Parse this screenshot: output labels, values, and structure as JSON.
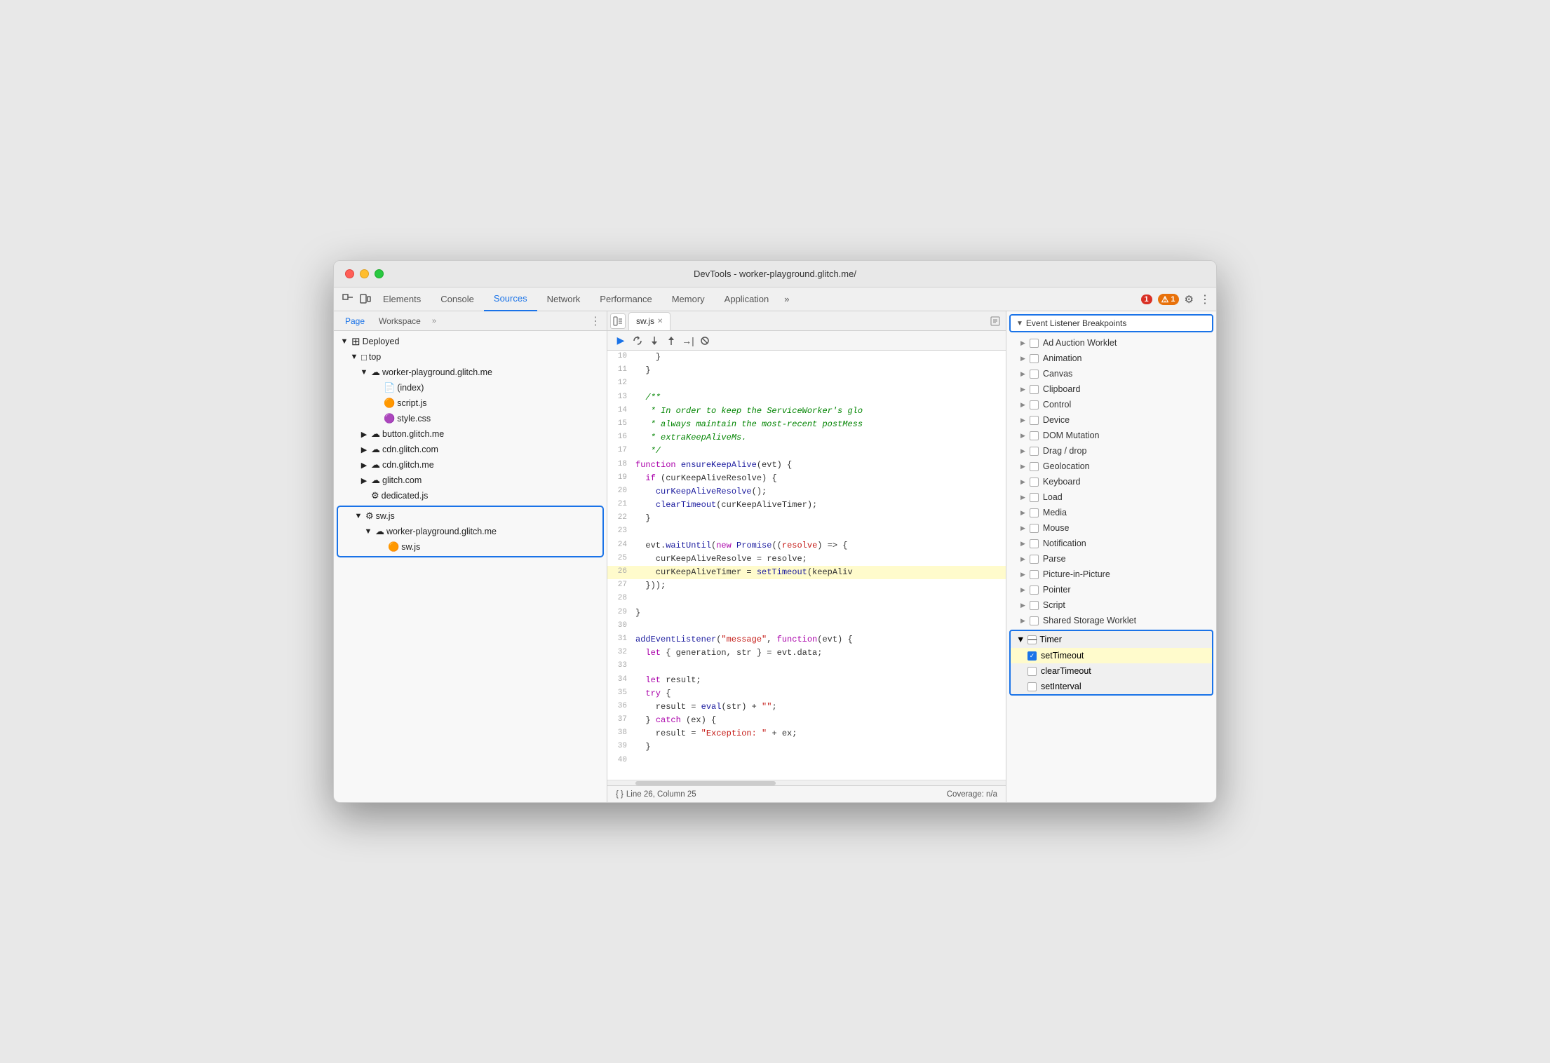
{
  "window": {
    "title": "DevTools - worker-playground.glitch.me/"
  },
  "topbar": {
    "tabs": [
      {
        "label": "Elements",
        "active": false
      },
      {
        "label": "Console",
        "active": false
      },
      {
        "label": "Sources",
        "active": true
      },
      {
        "label": "Network",
        "active": false
      },
      {
        "label": "Performance",
        "active": false
      },
      {
        "label": "Memory",
        "active": false
      },
      {
        "label": "Application",
        "active": false
      }
    ],
    "error_count": "1",
    "warn_count": "1"
  },
  "file_panel": {
    "tabs": [
      "Page",
      "Workspace"
    ],
    "active_tab": "Page",
    "tree": [
      {
        "level": 0,
        "label": "Deployed",
        "type": "folder",
        "indent": 8
      },
      {
        "level": 1,
        "label": "top",
        "type": "folder",
        "indent": 22
      },
      {
        "level": 2,
        "label": "worker-playground.glitch.me",
        "type": "cloud-folder",
        "indent": 36
      },
      {
        "level": 3,
        "label": "(index)",
        "type": "file",
        "indent": 52
      },
      {
        "level": 3,
        "label": "script.js",
        "type": "file-orange",
        "indent": 52
      },
      {
        "level": 3,
        "label": "style.css",
        "type": "file-purple",
        "indent": 52
      },
      {
        "level": 2,
        "label": "button.glitch.me",
        "type": "cloud-folder",
        "indent": 36
      },
      {
        "level": 2,
        "label": "cdn.glitch.com",
        "type": "cloud-folder",
        "indent": 36
      },
      {
        "level": 2,
        "label": "cdn.glitch.me",
        "type": "cloud-folder",
        "indent": 36
      },
      {
        "level": 2,
        "label": "glitch.com",
        "type": "cloud-folder",
        "indent": 36
      },
      {
        "level": 2,
        "label": "dedicated.js",
        "type": "gear-file",
        "indent": 36
      },
      {
        "level": 1,
        "label": "sw.js",
        "type": "gear-file",
        "indent": 22,
        "selected_group_start": true
      },
      {
        "level": 2,
        "label": "worker-playground.glitch.me",
        "type": "cloud-folder",
        "indent": 36
      },
      {
        "level": 3,
        "label": "sw.js",
        "type": "file-orange",
        "indent": 52,
        "selected_group_end": true
      }
    ]
  },
  "code_editor": {
    "filename": "sw.js",
    "lines": [
      {
        "num": 10,
        "content": "    }"
      },
      {
        "num": 11,
        "content": "  }"
      },
      {
        "num": 12,
        "content": ""
      },
      {
        "num": 13,
        "content": "  /**",
        "type": "comment"
      },
      {
        "num": 14,
        "content": "   * In order to keep the ServiceWorker's glo",
        "type": "comment"
      },
      {
        "num": 15,
        "content": "   * always maintain the most-recent postMess",
        "type": "comment"
      },
      {
        "num": 16,
        "content": "   * extraKeepAliveMs.",
        "type": "comment"
      },
      {
        "num": 17,
        "content": "   */",
        "type": "comment"
      },
      {
        "num": 18,
        "content": "function ensureKeepAlive(evt) {"
      },
      {
        "num": 19,
        "content": "  if (curKeepAliveResolve) {"
      },
      {
        "num": 20,
        "content": "    curKeepAliveResolve();"
      },
      {
        "num": 21,
        "content": "    clearTimeout(curKeepAliveTimer);"
      },
      {
        "num": 22,
        "content": "  }"
      },
      {
        "num": 23,
        "content": ""
      },
      {
        "num": 24,
        "content": "  evt.waitUntil(new Promise((resolve) => {"
      },
      {
        "num": 25,
        "content": "    curKeepAliveResolve = resolve;"
      },
      {
        "num": 26,
        "content": "    curKeepAliveTimer = setTimeout(keepAliv",
        "highlighted": true
      },
      {
        "num": 27,
        "content": "  }));"
      },
      {
        "num": 28,
        "content": ""
      },
      {
        "num": 29,
        "content": "}"
      },
      {
        "num": 30,
        "content": ""
      },
      {
        "num": 31,
        "content": "addEventListener(\"message\", function(evt) {"
      },
      {
        "num": 32,
        "content": "  let { generation, str } = evt.data;"
      },
      {
        "num": 33,
        "content": ""
      },
      {
        "num": 34,
        "content": "  let result;"
      },
      {
        "num": 35,
        "content": "  try {"
      },
      {
        "num": 36,
        "content": "    result = eval(str) + \"\";"
      },
      {
        "num": 37,
        "content": "  } catch (ex) {"
      },
      {
        "num": 38,
        "content": "    result = \"Exception: \" + ex;"
      },
      {
        "num": 39,
        "content": "  }"
      },
      {
        "num": 40,
        "content": ""
      }
    ],
    "statusbar": {
      "format_icon": "{ }",
      "position": "Line 26, Column 25",
      "coverage": "Coverage: n/a"
    }
  },
  "breakpoints": {
    "section_title": "Event Listener Breakpoints",
    "items": [
      {
        "label": "Ad Auction Worklet",
        "checked": false,
        "expandable": true
      },
      {
        "label": "Animation",
        "checked": false,
        "expandable": true
      },
      {
        "label": "Canvas",
        "checked": false,
        "expandable": true
      },
      {
        "label": "Clipboard",
        "checked": false,
        "expandable": true
      },
      {
        "label": "Control",
        "checked": false,
        "expandable": true
      },
      {
        "label": "Device",
        "checked": false,
        "expandable": true
      },
      {
        "label": "DOM Mutation",
        "checked": false,
        "expandable": true
      },
      {
        "label": "Drag / drop",
        "checked": false,
        "expandable": true
      },
      {
        "label": "Geolocation",
        "checked": false,
        "expandable": true
      },
      {
        "label": "Keyboard",
        "checked": false,
        "expandable": true
      },
      {
        "label": "Load",
        "checked": false,
        "expandable": true
      },
      {
        "label": "Media",
        "checked": false,
        "expandable": true
      },
      {
        "label": "Mouse",
        "checked": false,
        "expandable": true
      },
      {
        "label": "Notification",
        "checked": false,
        "expandable": true
      },
      {
        "label": "Parse",
        "checked": false,
        "expandable": true
      },
      {
        "label": "Picture-in-Picture",
        "checked": false,
        "expandable": true
      },
      {
        "label": "Pointer",
        "checked": false,
        "expandable": true
      },
      {
        "label": "Script",
        "checked": false,
        "expandable": true
      },
      {
        "label": "Shared Storage Worklet",
        "checked": false,
        "expandable": true
      }
    ],
    "timer_section": {
      "label": "Timer",
      "expanded": true,
      "subitems": [
        {
          "label": "setTimeout",
          "checked": true
        },
        {
          "label": "clearTimeout",
          "checked": false
        },
        {
          "label": "setInterval",
          "checked": false
        }
      ]
    }
  },
  "debug_toolbar": {
    "buttons": [
      "▶",
      "↺",
      "↓",
      "↑",
      "→|",
      "⊘"
    ]
  }
}
